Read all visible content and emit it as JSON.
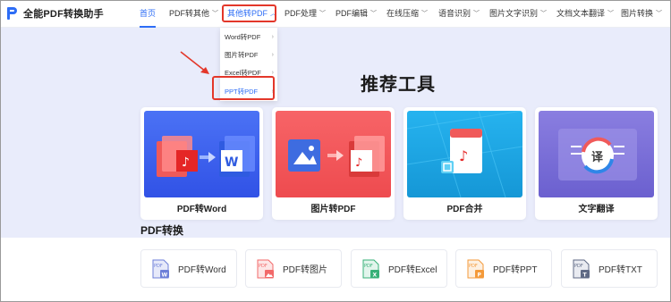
{
  "app": {
    "title": "全能PDF转换助手"
  },
  "nav": {
    "items": [
      {
        "label": "首页",
        "has_menu": false
      },
      {
        "label": "PDF转其他",
        "has_menu": true
      },
      {
        "label": "其他转PDF",
        "has_menu": true
      },
      {
        "label": "PDF处理",
        "has_menu": true
      },
      {
        "label": "PDF编辑",
        "has_menu": true
      },
      {
        "label": "在线压缩",
        "has_menu": true
      },
      {
        "label": "语音识别",
        "has_menu": true
      },
      {
        "label": "图片文字识别",
        "has_menu": true
      },
      {
        "label": "文档文本翻译",
        "has_menu": true
      },
      {
        "label": "图片转换",
        "has_menu": true
      }
    ],
    "current": "首页",
    "open_menu": "其他转PDF"
  },
  "dropdown": {
    "items": [
      {
        "label": "Word转PDF"
      },
      {
        "label": "图片转PDF"
      },
      {
        "label": "Excel转PDF"
      },
      {
        "label": "PPT转PDF"
      }
    ],
    "highlighted": "PPT转PDF"
  },
  "hero": {
    "title": "推荐工具"
  },
  "featured": [
    {
      "label": "PDF转Word",
      "color": "#3d62f0"
    },
    {
      "label": "图片转PDF",
      "color": "#f4575a"
    },
    {
      "label": "PDF合并",
      "color": "#1fa8e4"
    },
    {
      "label": "文字翻译",
      "color": "#7a6fd6"
    }
  ],
  "section": {
    "title": "PDF转换"
  },
  "tools": [
    {
      "label": "PDF转Word",
      "icon": "word-file-icon",
      "color": "#6d7fd8"
    },
    {
      "label": "PDF转图片",
      "icon": "image-file-icon",
      "color": "#f26a6a"
    },
    {
      "label": "PDF转Excel",
      "icon": "excel-file-icon",
      "color": "#37b077"
    },
    {
      "label": "PDF转PPT",
      "icon": "ppt-file-icon",
      "color": "#f49a3a"
    },
    {
      "label": "PDF转TXT",
      "icon": "txt-file-icon",
      "color": "#5f6a85"
    }
  ],
  "colors": {
    "accent": "#2d6df6",
    "annotation": "#e3372a",
    "hero_bg": "#e9ecfb"
  }
}
